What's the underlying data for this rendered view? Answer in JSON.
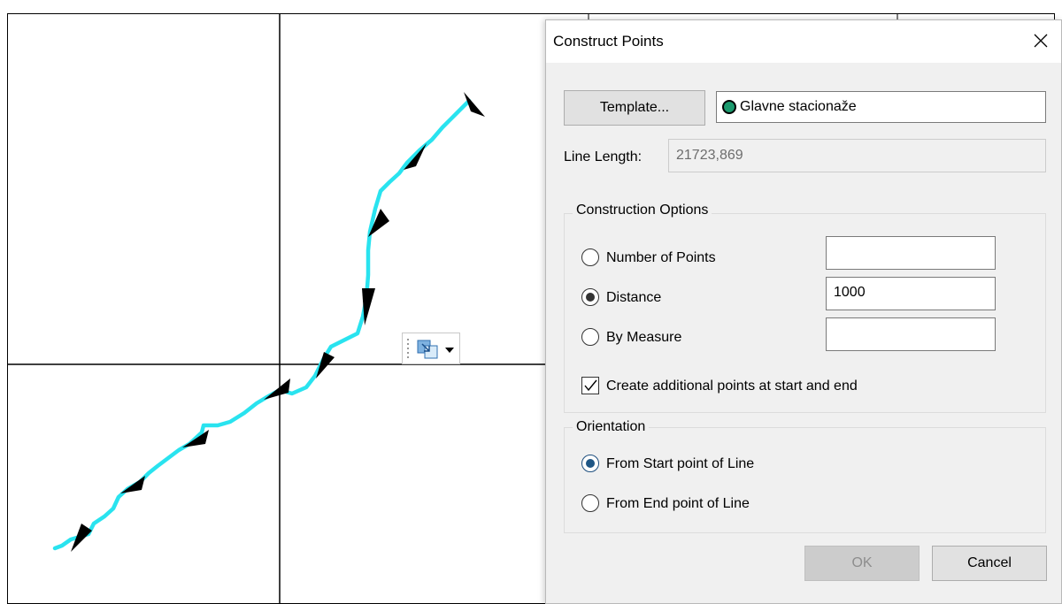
{
  "dialog": {
    "title": "Construct Points",
    "close_icon": "close-icon",
    "template_button_label": "Template...",
    "template_value": "Glavne stacionaže",
    "template_swatch_color": "#1c9a6e",
    "line_length_label": "Line Length:",
    "line_length_value": "21723,869",
    "construction_options": {
      "title": "Construction Options",
      "number_of_points_label": "Number of Points",
      "number_of_points_value": "",
      "distance_label": "Distance",
      "distance_value": "1000",
      "by_measure_label": "By Measure",
      "by_measure_value": "",
      "selected": "Distance",
      "additional_points_label": "Create additional points at start and end",
      "additional_points_checked": true
    },
    "orientation": {
      "title": "Orientation",
      "from_start_label": "From Start point of Line",
      "from_end_label": "From End point of Line",
      "selected": "From Start point of Line"
    },
    "ok_label": "OK",
    "cancel_label": "Cancel"
  },
  "map": {
    "line_color": "#29e3ef",
    "arrow_color": "#000000",
    "tool_icon": "snapping-tool-icon"
  }
}
